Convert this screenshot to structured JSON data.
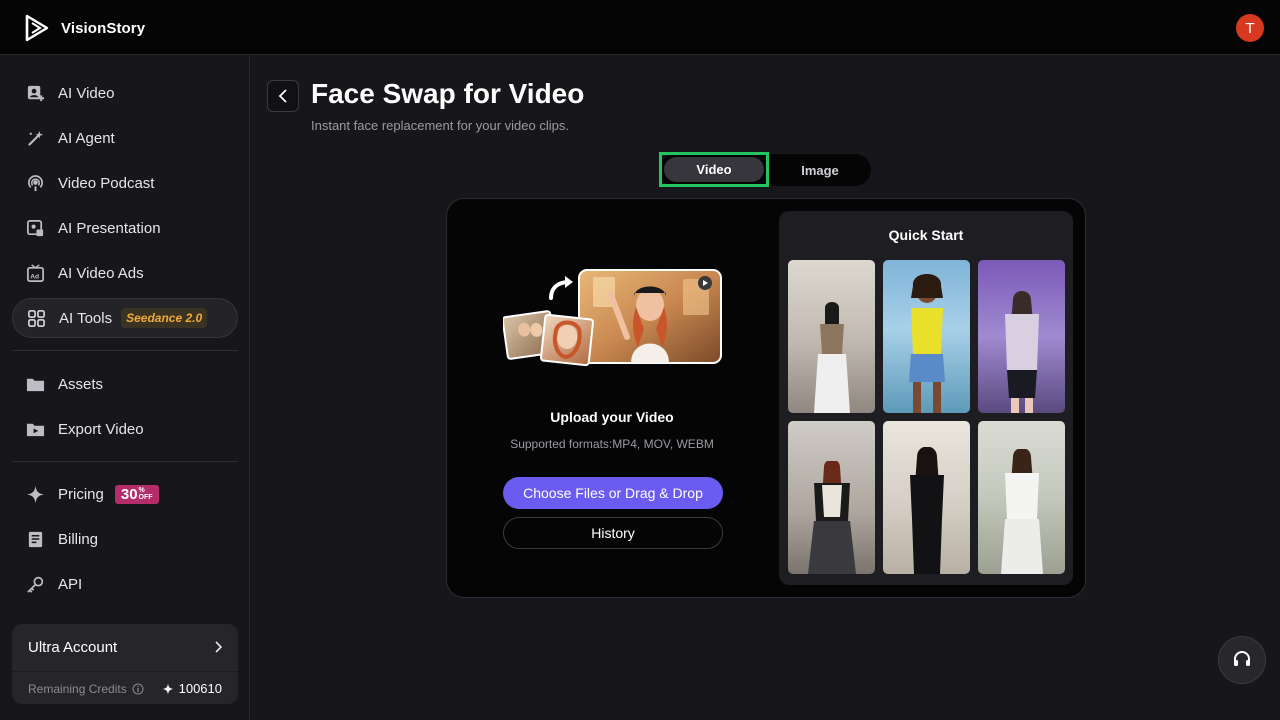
{
  "app": {
    "name": "VisionStory",
    "avatar_initial": "T"
  },
  "sidebar": {
    "items": [
      {
        "label": "AI Video",
        "icon": "ai-video-icon"
      },
      {
        "label": "AI Agent",
        "icon": "magic-wand-icon"
      },
      {
        "label": "Video Podcast",
        "icon": "podcast-icon"
      },
      {
        "label": "AI Presentation",
        "icon": "presentation-icon"
      },
      {
        "label": "AI Video Ads",
        "icon": "ads-icon"
      },
      {
        "label": "AI Tools",
        "icon": "grid-icon",
        "badge": "Seedance 2.0",
        "active": true
      },
      {
        "label": "Assets",
        "icon": "folder-icon"
      },
      {
        "label": "Export Video",
        "icon": "export-folder-icon"
      },
      {
        "label": "Pricing",
        "icon": "sparkle-icon",
        "badge_number": "30",
        "badge_unit_top": "%",
        "badge_unit_bottom": "OFF"
      },
      {
        "label": "Billing",
        "icon": "receipt-icon"
      },
      {
        "label": "API",
        "icon": "key-icon"
      }
    ],
    "account": {
      "title": "Ultra Account",
      "credits_label": "Remaining Credits",
      "credits_value": "100610"
    }
  },
  "main": {
    "title": "Face Swap for Video",
    "subtitle": "Instant face replacement for your video clips.",
    "tabs": [
      {
        "label": "Video",
        "selected": true
      },
      {
        "label": "Image",
        "selected": false
      }
    ],
    "upload": {
      "title": "Upload your Video",
      "formats": "Supported formats:MP4, MOV, WEBM",
      "choose_label": "Choose Files or Drag & Drop",
      "history_label": "History"
    },
    "quick_start": {
      "title": "Quick Start",
      "thumbnail_count": 6
    }
  },
  "colors": {
    "accent": "#6a5cf0",
    "highlight": "#22c55e",
    "avatar": "#d6391f",
    "badge_seedance": "#f0a93a",
    "badge_pricing": "#b52c6b"
  }
}
